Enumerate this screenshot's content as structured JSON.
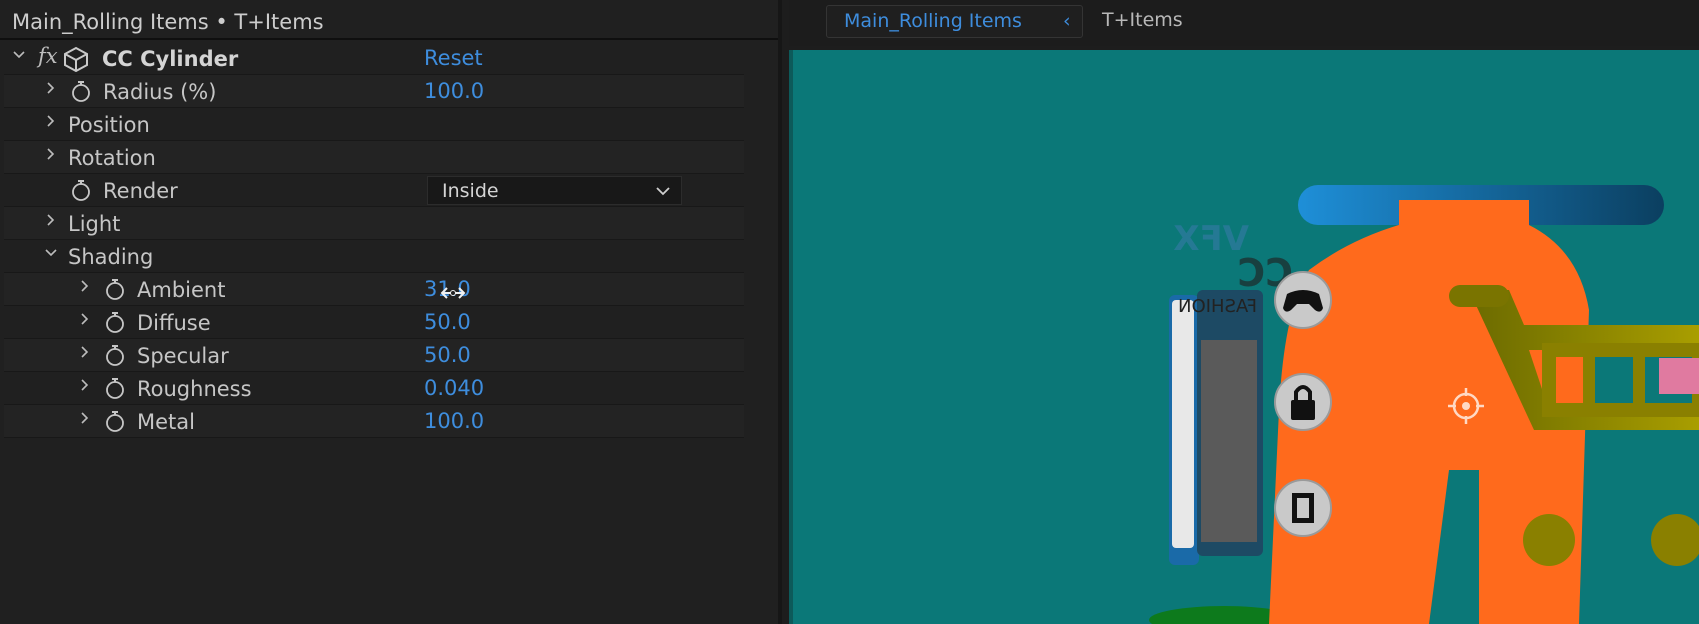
{
  "panel": {
    "title": "Main_Rolling Items • T+Items"
  },
  "effect": {
    "fx_label": "fx",
    "name": "CC Cylinder",
    "reset_label": "Reset"
  },
  "properties": {
    "radius": {
      "label": "Radius (%)",
      "value": "100.0"
    },
    "position": {
      "label": "Position"
    },
    "rotation": {
      "label": "Rotation"
    },
    "render": {
      "label": "Render",
      "value": "Inside"
    },
    "light": {
      "label": "Light"
    },
    "shading": {
      "label": "Shading"
    },
    "ambient": {
      "label": "Ambient",
      "value": "31.0"
    },
    "diffuse": {
      "label": "Diffuse",
      "value": "50.0"
    },
    "specular": {
      "label": "Specular",
      "value": "50.0"
    },
    "roughness": {
      "label": "Roughness",
      "value": "0.040"
    },
    "metal": {
      "label": "Metal",
      "value": "100.0"
    }
  },
  "viewer": {
    "active_tab": "Main_Rolling Items",
    "second_tab": "T+Items",
    "canvas_text": {
      "vfx": "VFX",
      "cc": "CC",
      "fashion": "FASHION"
    },
    "icons": [
      "gamepad-icon",
      "lock-icon",
      "film-icon",
      "anchor-point-icon"
    ]
  },
  "colors": {
    "accent_blue": "#3e8ddd",
    "canvas_teal": "#0b7878",
    "figure_orange": "#ff6a1c",
    "cart_olive": "#8a8000"
  }
}
